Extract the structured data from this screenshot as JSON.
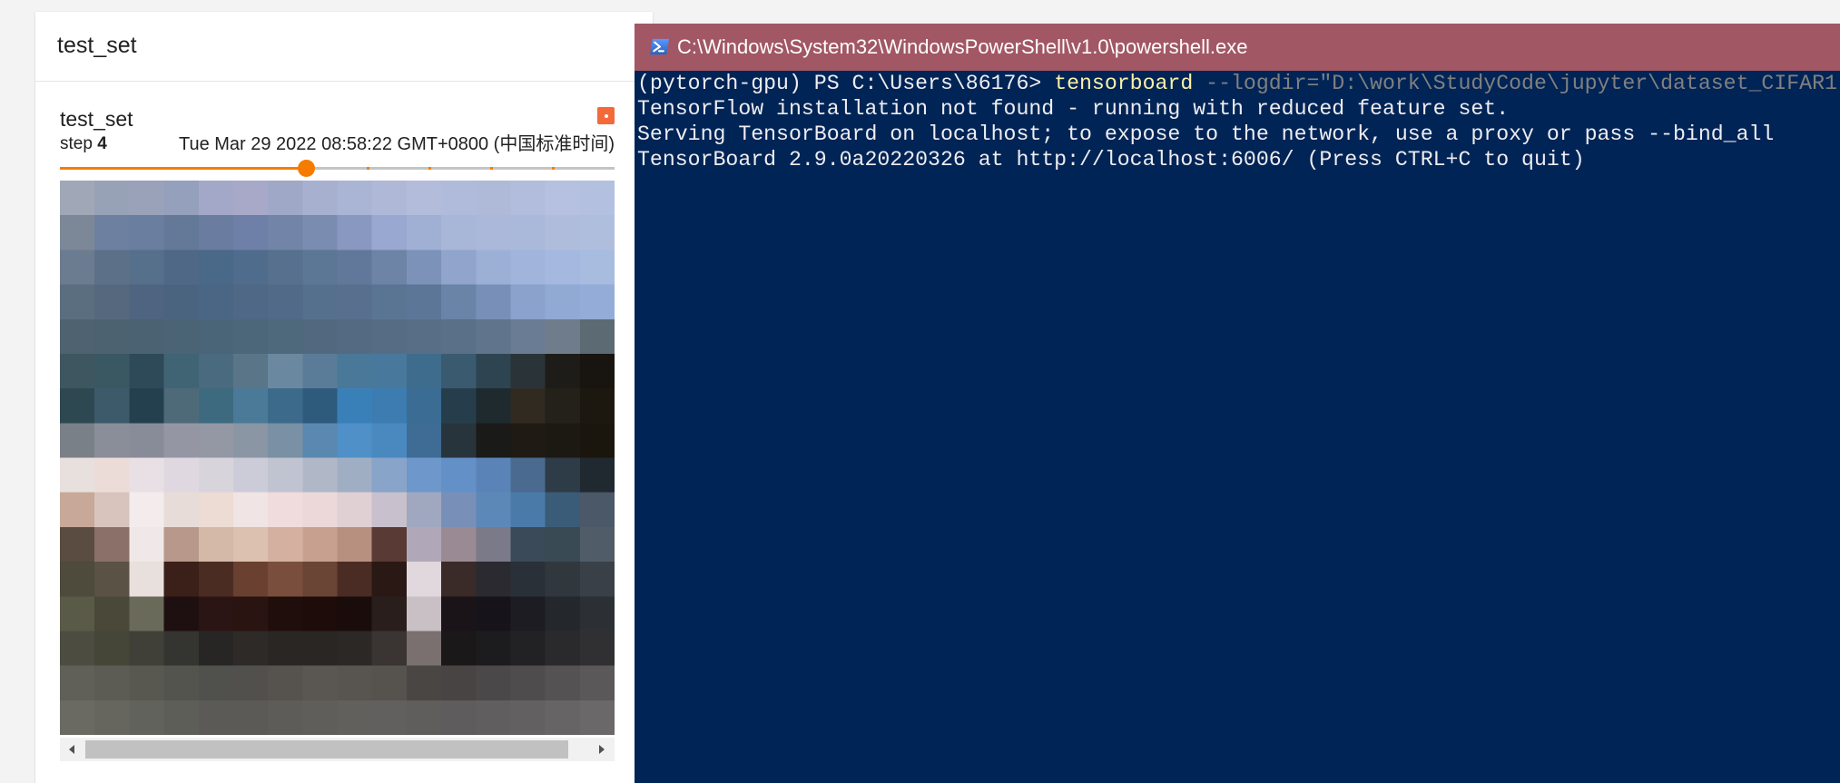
{
  "colors": {
    "accent": "#f57c00",
    "run_color": "#f4693a",
    "console_background": "#012456",
    "console_titlebar": "#a25764",
    "console_text": "#eeedf0",
    "console_command": "#f9f1a5",
    "console_argument": "#808080"
  },
  "panel": {
    "header_title": "test_set",
    "card": {
      "title": "test_set",
      "step_label": "step",
      "step_value": "4",
      "timestamp": "Tue Mar 29 2022 08:58:22 GMT+0800 (中国标准时间)",
      "run_color_icon": "run-color-icon",
      "slider": {
        "min": 0,
        "max": 9,
        "value": 4
      }
    }
  },
  "powershell": {
    "title": "C:\\Windows\\System32\\WindowsPowerShell\\v1.0\\powershell.exe",
    "icon": "powershell-icon",
    "lines": [
      {
        "prompt": "(pytorch-gpu) PS C:\\Users\\86176> ",
        "command": "tensorboard",
        "args": " --logdir=\"D:\\work\\StudyCode\\jupyter\\dataset_CIFAR1"
      },
      {
        "text": "TensorFlow installation not found - running with reduced feature set."
      },
      {
        "text": "Serving TensorBoard on localhost; to expose to the network, use a proxy or pass --bind_all"
      },
      {
        "text": "TensorBoard 2.9.0a20220326 at http://localhost:6006/ (Press CTRL+C to quit)"
      }
    ]
  }
}
